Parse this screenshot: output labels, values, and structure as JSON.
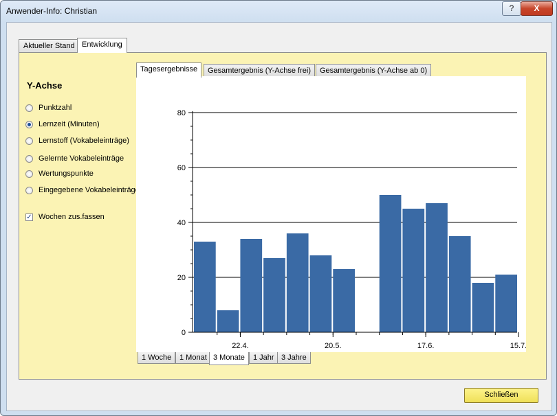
{
  "window": {
    "title": "Anwender-Info: Christian",
    "help_label": "?",
    "close_label": "X"
  },
  "outer_tabs": [
    {
      "label": "Aktueller Stand",
      "active": false
    },
    {
      "label": "Entwicklung",
      "active": true
    }
  ],
  "yaxis_panel": {
    "title": "Y-Achse",
    "options": [
      {
        "label": "Punktzahl",
        "selected": false
      },
      {
        "label": "Lernzeit (Minuten)",
        "selected": true
      },
      {
        "label": "Lernstoff (Vokabeleinträge)",
        "selected": false
      },
      {
        "label": "Gelernte Vokabeleinträge",
        "selected": false
      },
      {
        "label": "Wertungspunkte",
        "selected": false
      },
      {
        "label": "Eingegebene Vokabeleinträge",
        "selected": false
      }
    ],
    "checkbox": {
      "label": "Wochen zus.fassen",
      "checked": true,
      "mark": "✓"
    }
  },
  "chart_tabs": [
    {
      "label": "Tagesergebnisse",
      "active": true
    },
    {
      "label": "Gesamtergebnis (Y-Achse frei)",
      "active": false
    },
    {
      "label": "Gesamtergebnis (Y-Achse ab 0)",
      "active": false
    }
  ],
  "range_tabs": [
    {
      "label": "1 Woche",
      "active": false
    },
    {
      "label": "1 Monat",
      "active": false
    },
    {
      "label": "3 Monate",
      "active": true
    },
    {
      "label": "1 Jahr",
      "active": false
    },
    {
      "label": "3 Jahre",
      "active": false
    }
  ],
  "footer": {
    "close_button": "Schließen"
  },
  "chart_data": {
    "type": "bar",
    "values": [
      33,
      8,
      34,
      27,
      36,
      28,
      23,
      0,
      50,
      45,
      47,
      35,
      18,
      21
    ],
    "xtick_labels": [
      "22.4.",
      "20.5.",
      "17.6.",
      "15.7."
    ],
    "xtick_after_bar": [
      1,
      5,
      9,
      13
    ],
    "yticks": [
      0,
      20,
      40,
      60,
      80
    ],
    "ylim": [
      0,
      80
    ],
    "bar_color": "#3a6aa5",
    "grid": true
  }
}
